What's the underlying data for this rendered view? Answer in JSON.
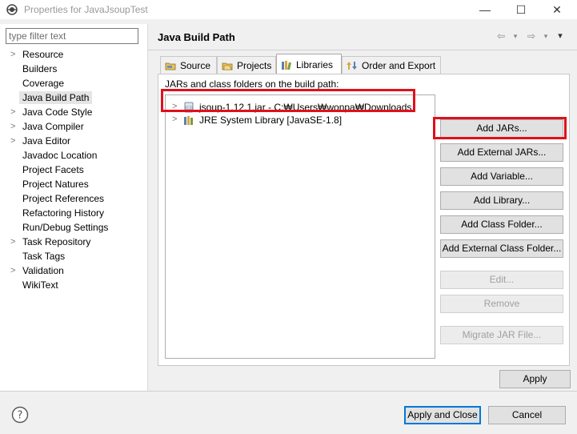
{
  "window": {
    "title": "Properties for JavaJsoupTest",
    "min_glyph": "—",
    "max_glyph": "☐",
    "close_glyph": "✕"
  },
  "sidebar": {
    "filter_placeholder": "type filter text",
    "items": [
      {
        "label": "Resource",
        "expandable": true
      },
      {
        "label": "Builders",
        "expandable": false
      },
      {
        "label": "Coverage",
        "expandable": false
      },
      {
        "label": "Java Build Path",
        "expandable": false,
        "selected": true
      },
      {
        "label": "Java Code Style",
        "expandable": true
      },
      {
        "label": "Java Compiler",
        "expandable": true
      },
      {
        "label": "Java Editor",
        "expandable": true
      },
      {
        "label": "Javadoc Location",
        "expandable": false
      },
      {
        "label": "Project Facets",
        "expandable": false
      },
      {
        "label": "Project Natures",
        "expandable": false
      },
      {
        "label": "Project References",
        "expandable": false
      },
      {
        "label": "Refactoring History",
        "expandable": false
      },
      {
        "label": "Run/Debug Settings",
        "expandable": false
      },
      {
        "label": "Task Repository",
        "expandable": true
      },
      {
        "label": "Task Tags",
        "expandable": false
      },
      {
        "label": "Validation",
        "expandable": true
      },
      {
        "label": "WikiText",
        "expandable": false
      }
    ]
  },
  "main": {
    "title": "Java Build Path",
    "nav": {
      "back": "⇦",
      "back_menu": "▾",
      "forward": "⇨",
      "forward_menu": "▾",
      "view_menu": "▾"
    },
    "tabs": [
      {
        "label": "Source",
        "icon": "source-folder-icon"
      },
      {
        "label": "Projects",
        "icon": "projects-icon"
      },
      {
        "label": "Libraries",
        "icon": "libraries-icon",
        "active": true
      },
      {
        "label": "Order and Export",
        "icon": "order-export-icon"
      }
    ],
    "caption": "JARs and class folders on the build path:",
    "entries": [
      {
        "label": "jsoup-1.12.1.jar - C:₩Users₩wonpa₩Downloads",
        "icon": "jar-icon",
        "highlighted": true
      },
      {
        "label": "JRE System Library [JavaSE-1.8]",
        "icon": "library-icon",
        "highlighted": false
      }
    ],
    "buttons": [
      {
        "label": "Add JARs...",
        "enabled": true
      },
      {
        "label": "Add External JARs...",
        "enabled": true,
        "highlighted": true
      },
      {
        "label": "Add Variable...",
        "enabled": true
      },
      {
        "label": "Add Library...",
        "enabled": true
      },
      {
        "label": "Add Class Folder...",
        "enabled": true
      },
      {
        "label": "Add External Class Folder...",
        "enabled": true
      },
      {
        "label": "Edit...",
        "enabled": false
      },
      {
        "label": "Remove",
        "enabled": false
      },
      {
        "label": "Migrate JAR File...",
        "enabled": false
      }
    ],
    "apply_label": "Apply"
  },
  "footer": {
    "help_glyph": "?",
    "apply_close_label": "Apply and Close",
    "cancel_label": "Cancel"
  },
  "colors": {
    "highlight": "#e0101b",
    "default_button_border": "#0078d7"
  }
}
